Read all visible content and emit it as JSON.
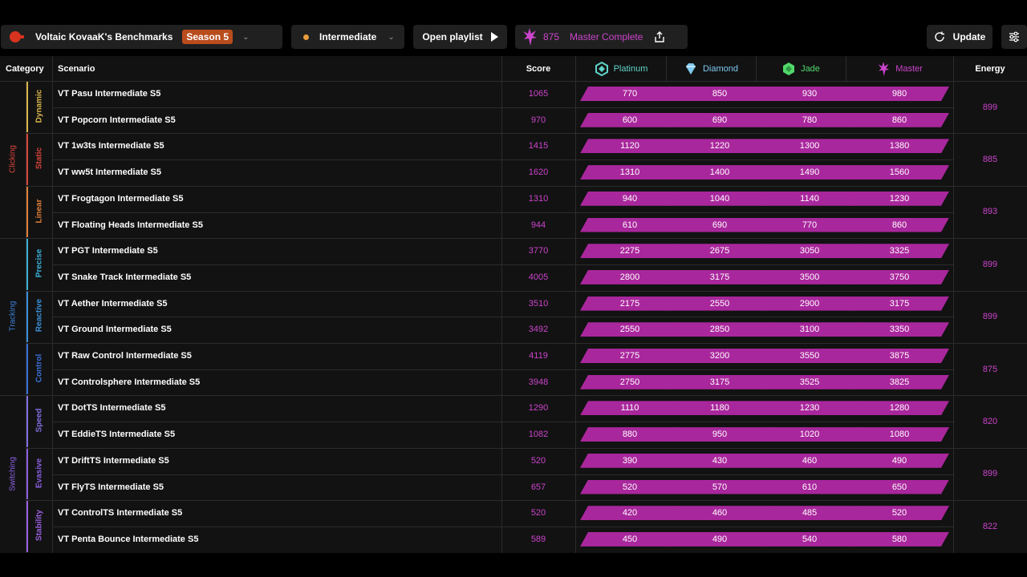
{
  "header": {
    "benchmark_title": "Voltaic KovaaK's Benchmarks",
    "season": "Season 5",
    "difficulty": "Intermediate",
    "open_playlist": "Open playlist",
    "energy": "875",
    "rank_status": "Master Complete",
    "update": "Update"
  },
  "columns": {
    "category": "Category",
    "scenario": "Scenario",
    "score": "Score",
    "energy": "Energy"
  },
  "ranks": [
    {
      "name": "Platinum",
      "color": "#5fd3c8"
    },
    {
      "name": "Diamond",
      "color": "#7fc9f0"
    },
    {
      "name": "Jade",
      "color": "#52d86b"
    },
    {
      "name": "Master",
      "color": "#cc44cc"
    }
  ],
  "categories": [
    {
      "name": "Clicking",
      "color": "#d8453a"
    },
    {
      "name": "Tracking",
      "color": "#3b7fd8"
    },
    {
      "name": "Switching",
      "color": "#8a5fe0"
    }
  ],
  "subcategories": [
    {
      "name": "Dynamic",
      "color": "#d8b54a",
      "energy": "899"
    },
    {
      "name": "Static",
      "color": "#d8453a",
      "energy": "885"
    },
    {
      "name": "Linear",
      "color": "#e0803a",
      "energy": "893"
    },
    {
      "name": "Precise",
      "color": "#3bb0d8",
      "energy": "899"
    },
    {
      "name": "Reactive",
      "color": "#3b8fd8",
      "energy": "899"
    },
    {
      "name": "Control",
      "color": "#3b6fd8",
      "energy": "875"
    },
    {
      "name": "Speed",
      "color": "#7f6fe0",
      "energy": "820"
    },
    {
      "name": "Evasive",
      "color": "#8a5fe0",
      "energy": "899"
    },
    {
      "name": "Stability",
      "color": "#9a5fe0",
      "energy": "822"
    }
  ],
  "rows": [
    {
      "scenario": "VT Pasu Intermediate S5",
      "score": "1065",
      "thresholds": [
        "770",
        "850",
        "930",
        "980"
      ]
    },
    {
      "scenario": "VT Popcorn Intermediate S5",
      "score": "970",
      "thresholds": [
        "600",
        "690",
        "780",
        "860"
      ]
    },
    {
      "scenario": "VT 1w3ts Intermediate S5",
      "score": "1415",
      "thresholds": [
        "1120",
        "1220",
        "1300",
        "1380"
      ]
    },
    {
      "scenario": "VT ww5t Intermediate S5",
      "score": "1620",
      "thresholds": [
        "1310",
        "1400",
        "1490",
        "1560"
      ]
    },
    {
      "scenario": "VT Frogtagon Intermediate S5",
      "score": "1310",
      "thresholds": [
        "940",
        "1040",
        "1140",
        "1230"
      ]
    },
    {
      "scenario": "VT Floating Heads Intermediate S5",
      "score": "944",
      "thresholds": [
        "610",
        "690",
        "770",
        "860"
      ]
    },
    {
      "scenario": "VT PGT Intermediate S5",
      "score": "3770",
      "thresholds": [
        "2275",
        "2675",
        "3050",
        "3325"
      ]
    },
    {
      "scenario": "VT Snake Track Intermediate S5",
      "score": "4005",
      "thresholds": [
        "2800",
        "3175",
        "3500",
        "3750"
      ]
    },
    {
      "scenario": "VT Aether Intermediate S5",
      "score": "3510",
      "thresholds": [
        "2175",
        "2550",
        "2900",
        "3175"
      ]
    },
    {
      "scenario": "VT Ground Intermediate S5",
      "score": "3492",
      "thresholds": [
        "2550",
        "2850",
        "3100",
        "3350"
      ]
    },
    {
      "scenario": "VT Raw Control Intermediate S5",
      "score": "4119",
      "thresholds": [
        "2775",
        "3200",
        "3550",
        "3875"
      ]
    },
    {
      "scenario": "VT Controlsphere Intermediate S5",
      "score": "3948",
      "thresholds": [
        "2750",
        "3175",
        "3525",
        "3825"
      ]
    },
    {
      "scenario": "VT DotTS Intermediate S5",
      "score": "1290",
      "thresholds": [
        "1110",
        "1180",
        "1230",
        "1280"
      ]
    },
    {
      "scenario": "VT EddieTS Intermediate S5",
      "score": "1082",
      "thresholds": [
        "880",
        "950",
        "1020",
        "1080"
      ]
    },
    {
      "scenario": "VT DriftTS Intermediate S5",
      "score": "520",
      "thresholds": [
        "390",
        "430",
        "460",
        "490"
      ]
    },
    {
      "scenario": "VT FlyTS Intermediate S5",
      "score": "657",
      "thresholds": [
        "520",
        "570",
        "610",
        "650"
      ]
    },
    {
      "scenario": "VT ControlTS Intermediate S5",
      "score": "520",
      "thresholds": [
        "420",
        "460",
        "485",
        "520"
      ]
    },
    {
      "scenario": "VT Penta Bounce Intermediate S5",
      "score": "589",
      "thresholds": [
        "450",
        "490",
        "540",
        "580"
      ]
    }
  ]
}
